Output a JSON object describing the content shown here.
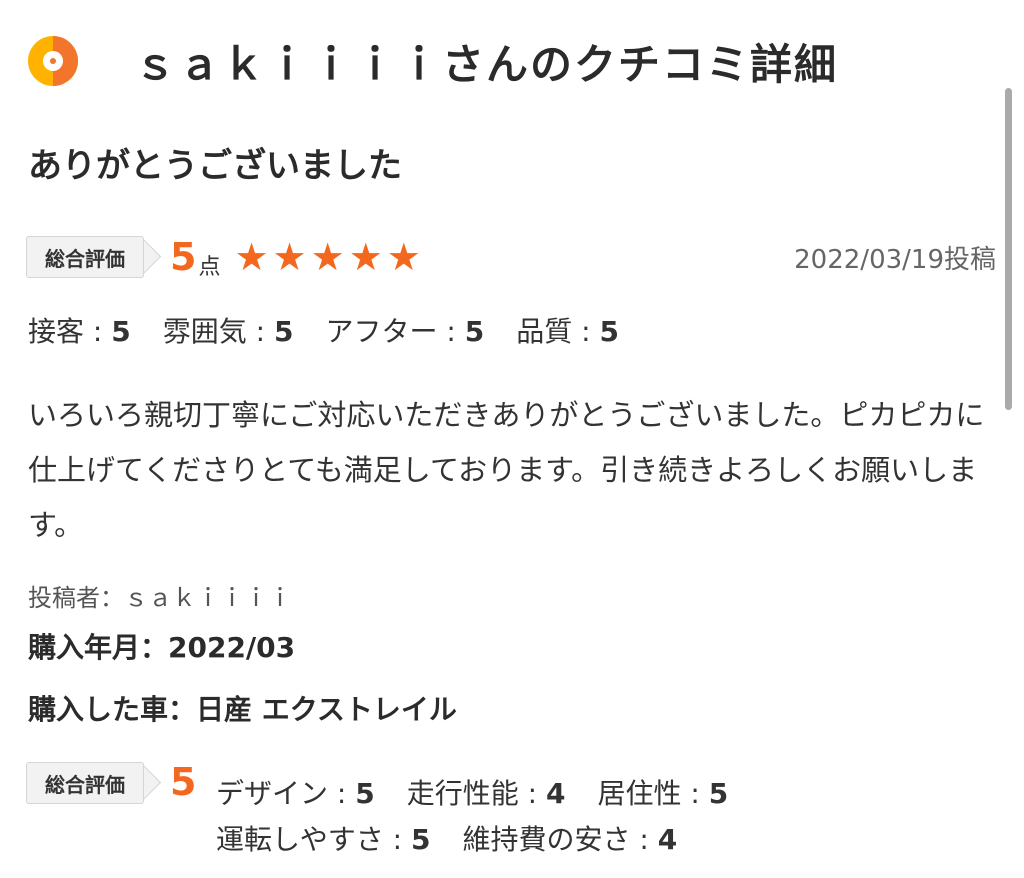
{
  "header": {
    "title": "ｓａｋｉｉｉｉさんのクチコミ詳細"
  },
  "review": {
    "title": "ありがとうございました",
    "overall_label": "総合評価",
    "overall_score": "5",
    "score_unit": "点",
    "stars": 5,
    "date": "2022/03/19投稿",
    "sub_ratings": [
      {
        "label": "接客 : ",
        "value": "5"
      },
      {
        "label": "雰囲気 : ",
        "value": "5"
      },
      {
        "label": "アフター : ",
        "value": "5"
      },
      {
        "label": "品質 : ",
        "value": "5"
      }
    ],
    "body": "いろいろ親切丁寧にご対応いただきありがとうございました。ピカピカに仕上げてくださりとても満足しております。引き続きよろしくお願いします。",
    "poster": "投稿者：ｓａｋｉｉｉｉ",
    "purchase_date": "購入年月：2022/03",
    "car": "購入した車：日産 エクストレイル"
  },
  "vehicle_rating": {
    "label": "総合評価",
    "score": "5",
    "items": [
      {
        "label": "デザイン : ",
        "value": "5"
      },
      {
        "label": "走行性能 : ",
        "value": "4"
      },
      {
        "label": "居住性 : ",
        "value": "5"
      },
      {
        "label": "運転しやすさ : ",
        "value": "5"
      },
      {
        "label": "維持費の安さ : ",
        "value": "4"
      }
    ]
  },
  "colors": {
    "accent": "#f3681e",
    "logo_left": "#ffb300",
    "logo_right": "#f3742b"
  },
  "icons": {
    "logo": "review-logo-icon",
    "star": "star-icon"
  }
}
